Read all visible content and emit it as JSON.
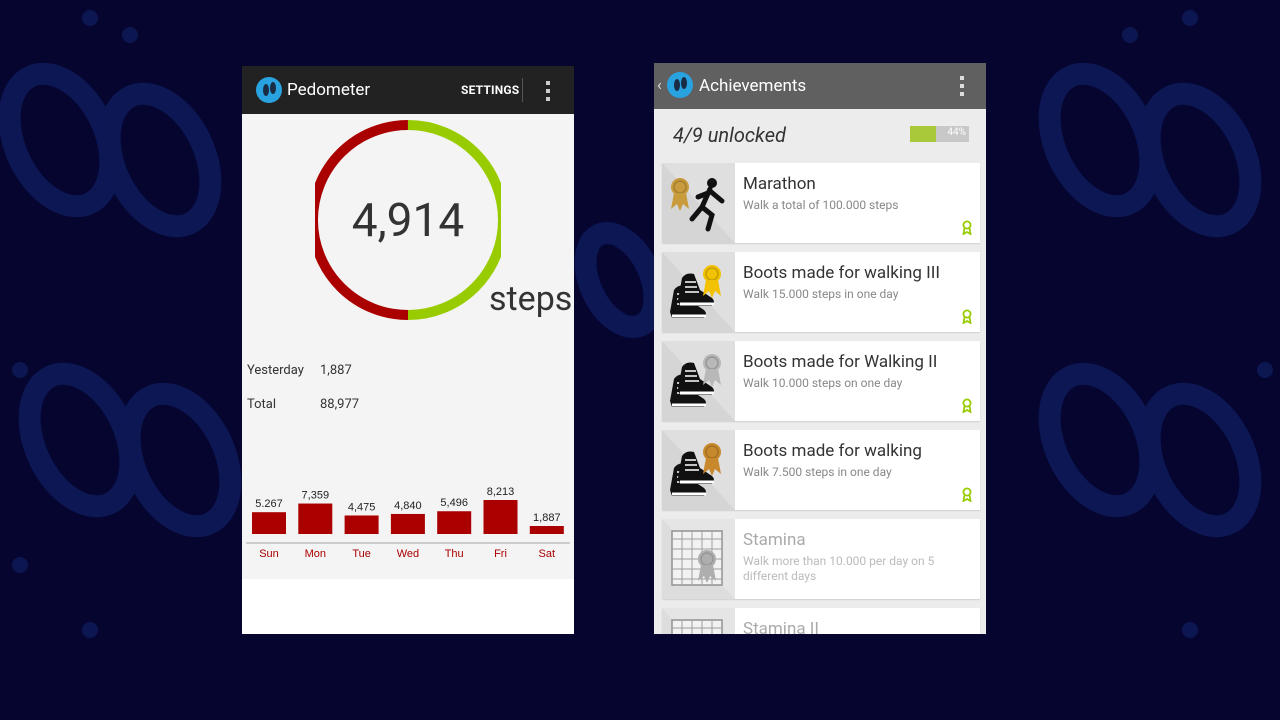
{
  "pedometer": {
    "app_title": "Pedometer",
    "settings_label": "SETTINGS",
    "steps_today": "4,914",
    "steps_unit": "steps",
    "progress_fraction": 0.5,
    "stats": {
      "yesterday_label": "Yesterday",
      "yesterday_value": "1,887",
      "total_label": "Total",
      "total_value": "88,977"
    },
    "colors": {
      "progress": "#99cc00",
      "remaining": "#aa0000",
      "bar": "#aa0000"
    }
  },
  "chart_data": {
    "type": "bar",
    "categories": [
      "Sun",
      "Mon",
      "Tue",
      "Wed",
      "Thu",
      "Fri",
      "Sat"
    ],
    "values": [
      5267,
      7359,
      4475,
      4840,
      5496,
      8213,
      1887
    ],
    "value_labels": [
      "5.267",
      "7,359",
      "4,475",
      "4,840",
      "5,496",
      "8,213",
      "1,887"
    ],
    "ylim": [
      0,
      8213
    ]
  },
  "achievements": {
    "app_title": "Achievements",
    "unlocked_text": "4/9 unlocked",
    "progress_fraction": 0.44,
    "progress_label": "44%",
    "items": [
      {
        "title": "Marathon",
        "desc": "Walk a total of 100.000 steps",
        "unlocked": true,
        "icon": "runner-icon",
        "medal_color": "#c89b3c"
      },
      {
        "title": "Boots made for walking III",
        "desc": "Walk 15.000 steps in one day",
        "unlocked": true,
        "icon": "sneakers-icon",
        "medal_color": "#f2c200"
      },
      {
        "title": "Boots made for Walking II",
        "desc": "Walk 10.000 steps on one day",
        "unlocked": true,
        "icon": "sneakers-icon",
        "medal_color": "#b8b8b8"
      },
      {
        "title": "Boots made for walking",
        "desc": "Walk 7.500 steps in one day",
        "unlocked": true,
        "icon": "sneakers-icon",
        "medal_color": "#c8892c"
      },
      {
        "title": "Stamina",
        "desc": "Walk more than 10.000 per day on 5 different days",
        "unlocked": false,
        "icon": "calendar-icon",
        "medal_color": "#9a9a9a"
      },
      {
        "title": "Stamina II",
        "desc": "",
        "unlocked": false,
        "icon": "calendar-icon",
        "medal_color": "#9a9a9a"
      }
    ]
  }
}
